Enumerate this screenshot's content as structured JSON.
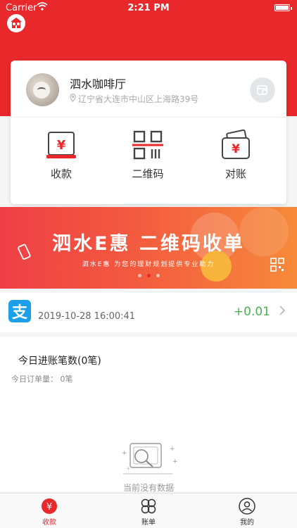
{
  "status_bar": {
    "carrier": "Carrier",
    "time": "2:21 PM"
  },
  "store": {
    "name": "泗水咖啡厅",
    "address": "辽宁省大连市中山区上海路39号"
  },
  "features": [
    {
      "label": "收款",
      "icon": "cash-register-icon"
    },
    {
      "label": "二维码",
      "icon": "qr-code-icon"
    },
    {
      "label": "对账",
      "icon": "wallet-icon"
    }
  ],
  "banner": {
    "title": "泗水E惠  二维码收单",
    "subtitle": "泗水E惠  为您的理财规划提供专业助力",
    "slides": 3,
    "active_slide": 1
  },
  "transaction": {
    "method_icon": "alipay-icon",
    "time": "2019-10-28 16:00:41",
    "amount": "+0.01"
  },
  "summary": {
    "title": "今日进账笔数(0笔)",
    "subtitle": "今日订单量：  0笔",
    "empty_text": "当前没有数据"
  },
  "tabbar": [
    {
      "label": "收款",
      "icon": "yuan-coin-icon",
      "active": true
    },
    {
      "label": "账单",
      "icon": "four-leaf-icon",
      "active": false
    },
    {
      "label": "我的",
      "icon": "user-icon",
      "active": false
    }
  ],
  "colors": {
    "brand_red": "#e8282b",
    "positive_green": "#4caf50",
    "alipay_blue": "#1a9fe8"
  }
}
